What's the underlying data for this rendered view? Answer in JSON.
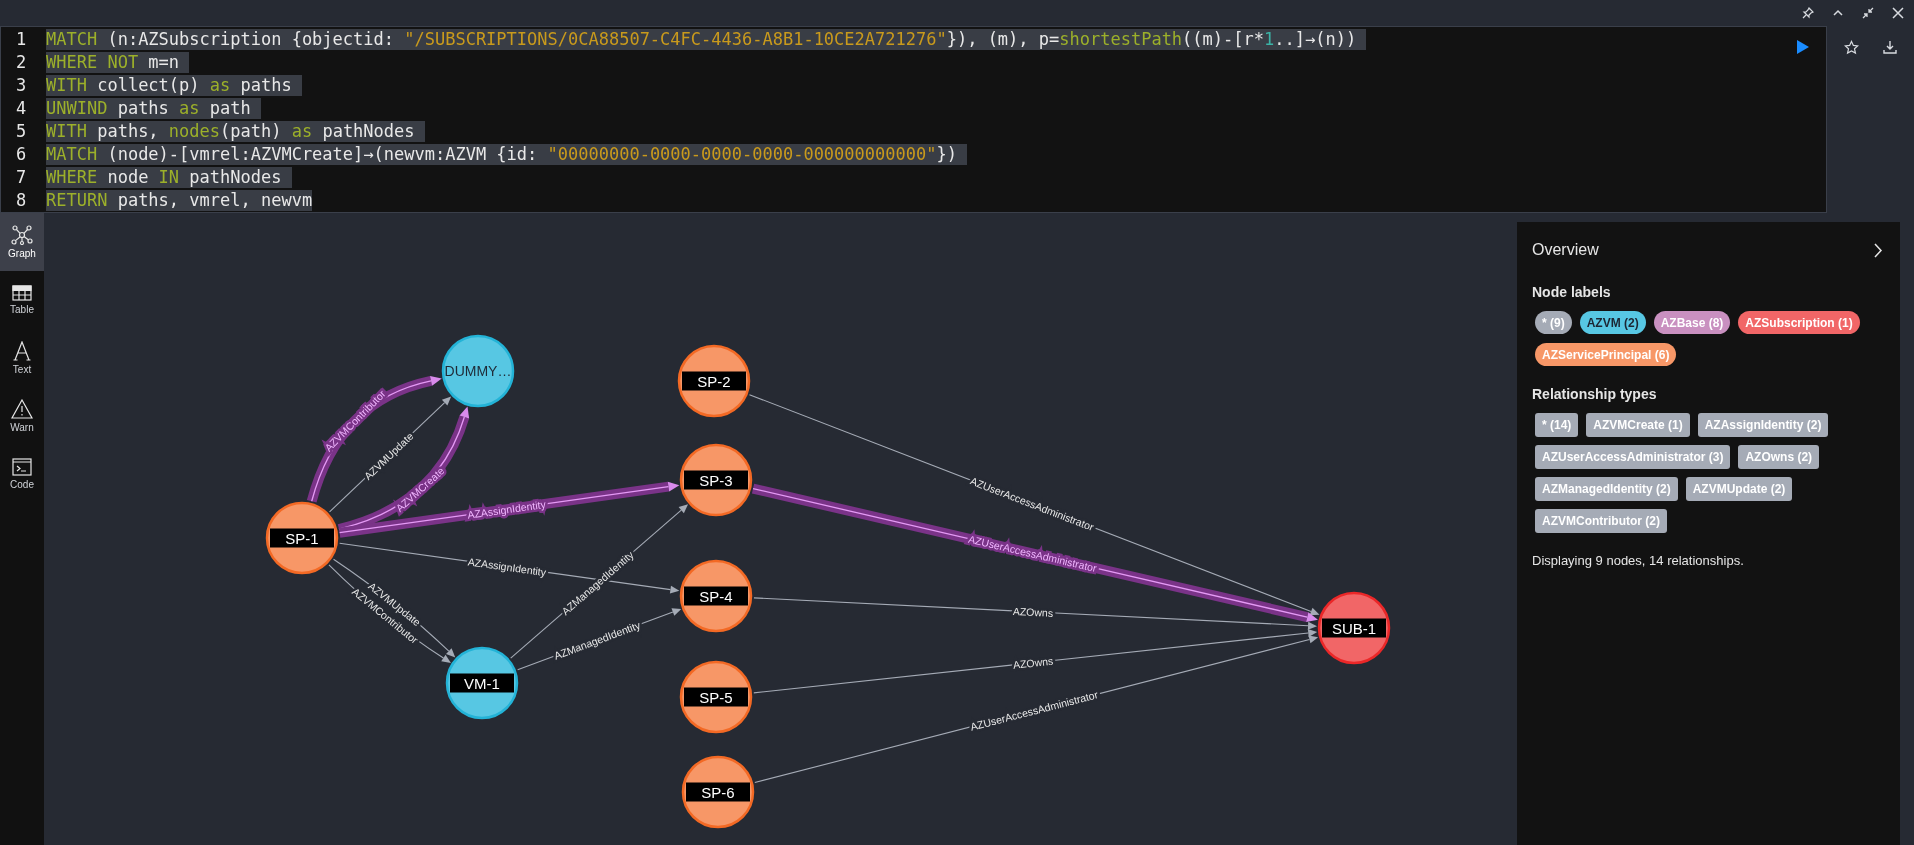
{
  "editor": {
    "lines": [
      {
        "number": "1",
        "tokens": [
          {
            "kind": "keyword",
            "text": "MATCH"
          },
          {
            "kind": "plain",
            "text": " (n:AZSubscription {objectid: "
          },
          {
            "kind": "string",
            "text": "\"/SUBSCRIPTIONS/0CA88507-C4FC-4436-A8B1-10CE2A721276\""
          },
          {
            "kind": "plain",
            "text": "}), (m), p="
          },
          {
            "kind": "keyword",
            "text": "shortestPath"
          },
          {
            "kind": "plain",
            "text": "((m)-[r*"
          },
          {
            "kind": "number",
            "text": "1"
          },
          {
            "kind": "plain",
            "text": "..]→(n)) "
          }
        ]
      },
      {
        "number": "2",
        "tokens": [
          {
            "kind": "keyword",
            "text": "WHERE NOT"
          },
          {
            "kind": "plain",
            "text": " m=n "
          }
        ]
      },
      {
        "number": "3",
        "tokens": [
          {
            "kind": "keyword",
            "text": "WITH"
          },
          {
            "kind": "plain",
            "text": " collect(p) "
          },
          {
            "kind": "keyword",
            "text": "as"
          },
          {
            "kind": "plain",
            "text": " paths "
          }
        ]
      },
      {
        "number": "4",
        "tokens": [
          {
            "kind": "keyword",
            "text": "UNWIND"
          },
          {
            "kind": "plain",
            "text": " paths "
          },
          {
            "kind": "keyword",
            "text": "as"
          },
          {
            "kind": "plain",
            "text": " path "
          }
        ]
      },
      {
        "number": "5",
        "tokens": [
          {
            "kind": "keyword",
            "text": "WITH"
          },
          {
            "kind": "plain",
            "text": " paths, "
          },
          {
            "kind": "keyword",
            "text": "nodes"
          },
          {
            "kind": "plain",
            "text": "(path) "
          },
          {
            "kind": "keyword",
            "text": "as"
          },
          {
            "kind": "plain",
            "text": " pathNodes "
          }
        ]
      },
      {
        "number": "6",
        "tokens": [
          {
            "kind": "keyword",
            "text": "MATCH"
          },
          {
            "kind": "plain",
            "text": " (node)-[vmrel:AZVMCreate]→(newvm:AZVM {id: "
          },
          {
            "kind": "string",
            "text": "\"00000000-0000-0000-0000-000000000000\""
          },
          {
            "kind": "plain",
            "text": "}) "
          }
        ]
      },
      {
        "number": "7",
        "tokens": [
          {
            "kind": "keyword",
            "text": "WHERE"
          },
          {
            "kind": "plain",
            "text": " node "
          },
          {
            "kind": "keyword",
            "text": "IN"
          },
          {
            "kind": "plain",
            "text": " pathNodes "
          }
        ]
      },
      {
        "number": "8",
        "tokens": [
          {
            "kind": "keyword",
            "text": "RETURN"
          },
          {
            "kind": "plain",
            "text": " paths, vmrel, newvm"
          }
        ]
      }
    ]
  },
  "sidebar": {
    "items": [
      {
        "label": "Graph",
        "selected": true
      },
      {
        "label": "Table",
        "selected": false
      },
      {
        "label": "Text",
        "selected": false
      },
      {
        "label": "Warn",
        "selected": false
      },
      {
        "label": "Code",
        "selected": false
      }
    ]
  },
  "graph": {
    "nodes": [
      {
        "caption": "DUMMY…",
        "kind": "vm",
        "caption_band": false
      },
      {
        "caption": "SP-1",
        "kind": "service_principal",
        "caption_band": true
      },
      {
        "caption": "VM-1",
        "kind": "vm",
        "caption_band": true
      },
      {
        "caption": "SP-2",
        "kind": "service_principal",
        "caption_band": true
      },
      {
        "caption": "SP-3",
        "kind": "service_principal",
        "caption_band": true
      },
      {
        "caption": "SP-4",
        "kind": "service_principal",
        "caption_band": true
      },
      {
        "caption": "SP-5",
        "kind": "service_principal",
        "caption_band": true
      },
      {
        "caption": "SP-6",
        "kind": "service_principal",
        "caption_band": true
      },
      {
        "caption": "SUB-1",
        "kind": "subscription",
        "caption_band": true
      }
    ],
    "relationships": [
      {
        "type": "AZVMContributor",
        "highlighted": true
      },
      {
        "type": "AZVMUpdate",
        "highlighted": false
      },
      {
        "type": "AZVMCreate",
        "highlighted": true
      },
      {
        "type": "AZAssignIdentity",
        "highlighted": true
      },
      {
        "type": "AZAssignIdentity",
        "highlighted": false
      },
      {
        "type": "AZVMUpdate",
        "highlighted": false
      },
      {
        "type": "AZVMContributor",
        "highlighted": false
      },
      {
        "type": "AZManagedIdentity",
        "highlighted": false
      },
      {
        "type": "AZManagedIdentity",
        "highlighted": false
      },
      {
        "type": "AZUserAccessAdministrator",
        "highlighted": false
      },
      {
        "type": "AZUserAccessAdministrator",
        "highlighted": true
      },
      {
        "type": "AZOwns",
        "highlighted": false
      },
      {
        "type": "AZOwns",
        "highlighted": false
      },
      {
        "type": "AZUserAccessAdministrator",
        "highlighted": false
      }
    ]
  },
  "overview": {
    "title": "Overview",
    "node_labels_heading": "Node labels",
    "node_labels": [
      {
        "text": "* (9)",
        "color": "#a5abb6"
      },
      {
        "text": "AZVM (2)",
        "color": "#57c7e3"
      },
      {
        "text": "AZBase (8)",
        "color": "#c990c0"
      },
      {
        "text": "AZSubscription (1)",
        "color": "#f16667"
      },
      {
        "text": "AZServicePrincipal (6)",
        "color": "#f79767"
      }
    ],
    "relationship_types_heading": "Relationship types",
    "relationship_types": [
      "* (14)",
      "AZVMCreate (1)",
      "AZAssignIdentity (2)",
      "AZUserAccessAdministrator (3)",
      "AZOwns (2)",
      "AZManagedIdentity (2)",
      "AZVMUpdate (2)",
      "AZVMContributor (2)"
    ],
    "summary": "Displaying 9 nodes, 14 relationships."
  }
}
